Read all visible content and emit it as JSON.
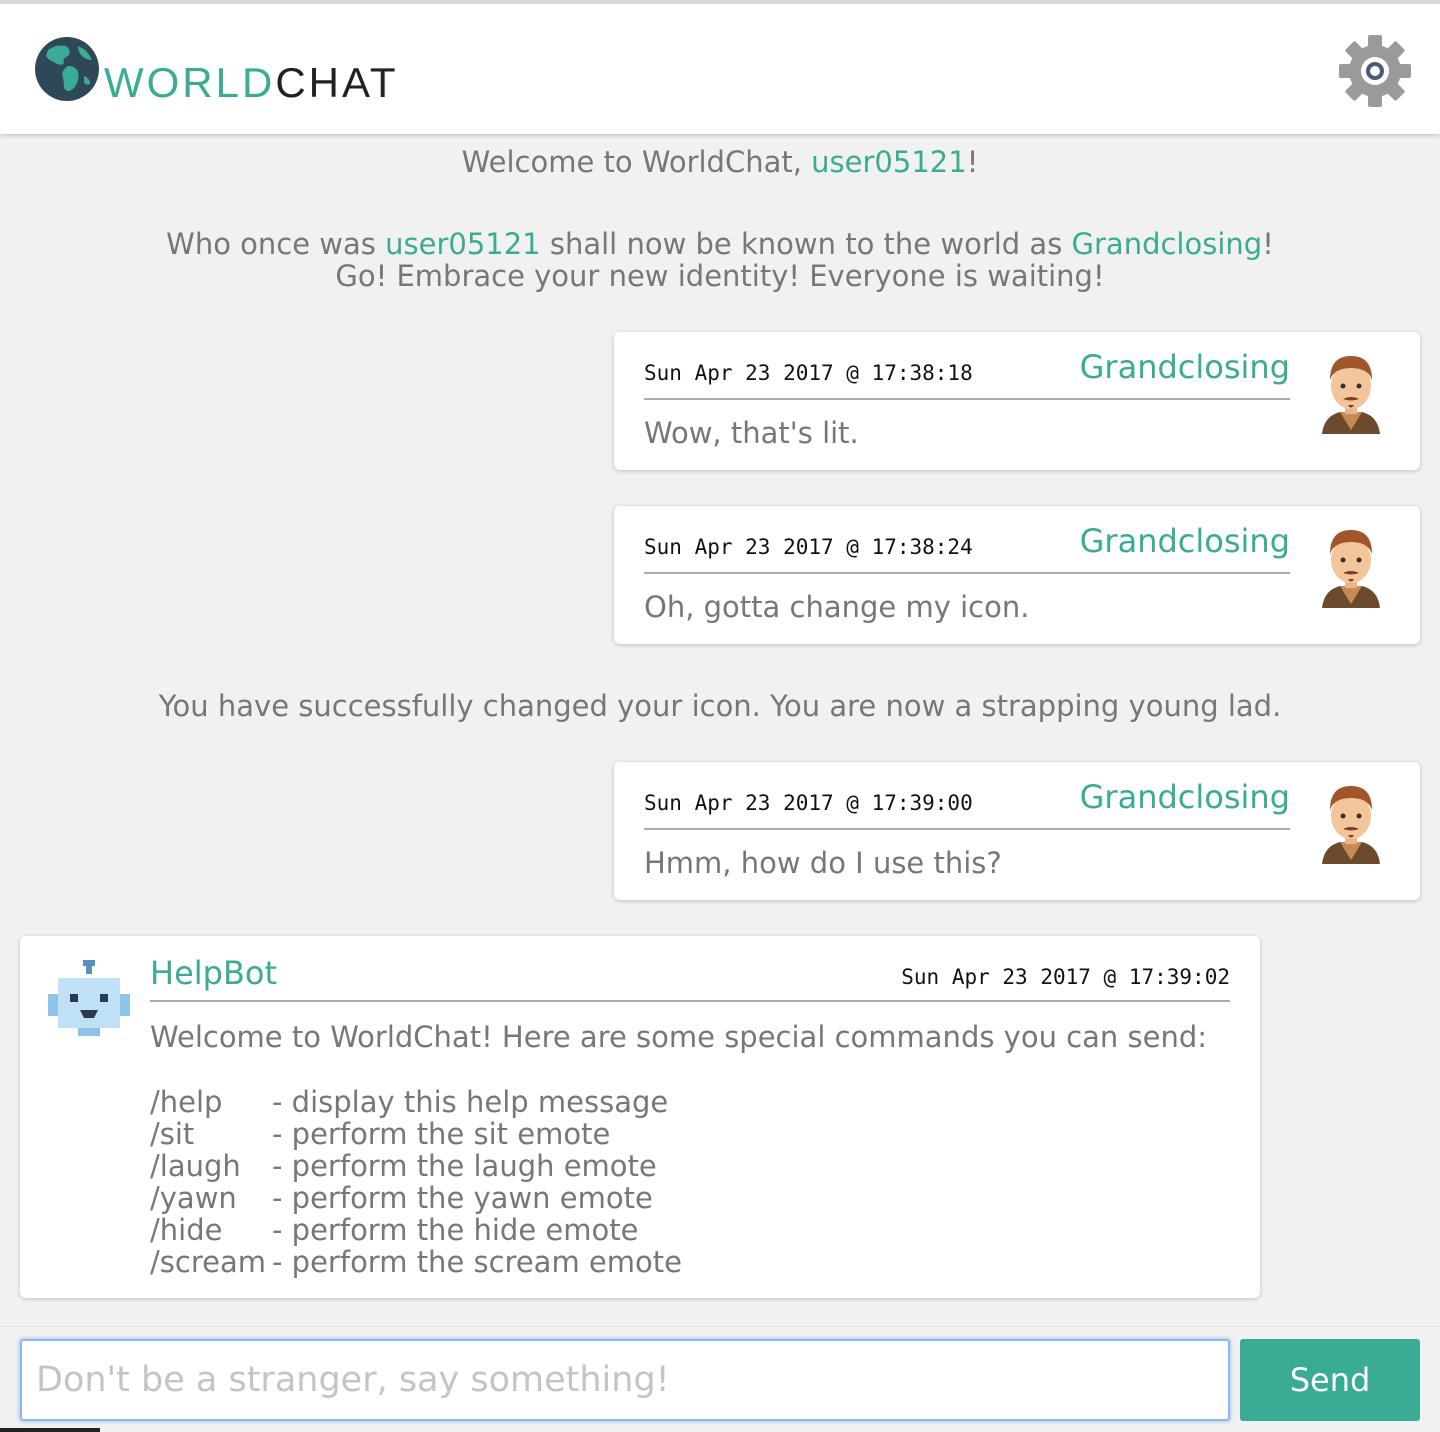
{
  "app": {
    "logo_world": "WORLD",
    "logo_chat": "CHAT",
    "settings_icon": "gear-icon"
  },
  "system_messages": {
    "welcome": {
      "prefix": "Welcome to WorldChat, ",
      "user": "user05121",
      "suffix": "!"
    },
    "rename": {
      "prefix": "Who once was ",
      "old_name": "user05121",
      "middle": " shall now be known to the world as ",
      "new_name": "Grandclosing",
      "suffix": "!",
      "line2": "Go! Embrace your new identity! Everyone is waiting!"
    },
    "icon_changed": "You have successfully changed your icon. You are now a strapping young lad."
  },
  "messages": [
    {
      "timestamp": "Sun Apr 23 2017 @ 17:38:18",
      "username": "Grandclosing",
      "text": "Wow, that's lit.",
      "avatar": "young-lad-avatar"
    },
    {
      "timestamp": "Sun Apr 23 2017 @ 17:38:24",
      "username": "Grandclosing",
      "text": "Oh, gotta change my icon.",
      "avatar": "young-lad-avatar"
    },
    {
      "timestamp": "Sun Apr 23 2017 @ 17:39:00",
      "username": "Grandclosing",
      "text": "Hmm, how do I use this?",
      "avatar": "young-lad-avatar"
    }
  ],
  "helpbot": {
    "username": "HelpBot",
    "timestamp": "Sun Apr 23 2017 @ 17:39:02",
    "intro": "Welcome to WorldChat! Here are some special commands you can send:",
    "avatar": "robot-avatar",
    "commands": [
      {
        "name": "/help",
        "desc": "- display this help message"
      },
      {
        "name": "/sit",
        "desc": "- perform the sit emote"
      },
      {
        "name": "/laugh",
        "desc": "- perform the laugh emote"
      },
      {
        "name": "/yawn",
        "desc": "- perform the yawn emote"
      },
      {
        "name": "/hide",
        "desc": "- perform the hide emote"
      },
      {
        "name": "/scream",
        "desc": "- perform the scream emote"
      }
    ]
  },
  "composer": {
    "placeholder": "Don't be a stranger, say something!",
    "value": "",
    "send_label": "Send"
  },
  "colors": {
    "accent": "#3aab95",
    "background": "#f1f1f1",
    "text": "#777777"
  }
}
